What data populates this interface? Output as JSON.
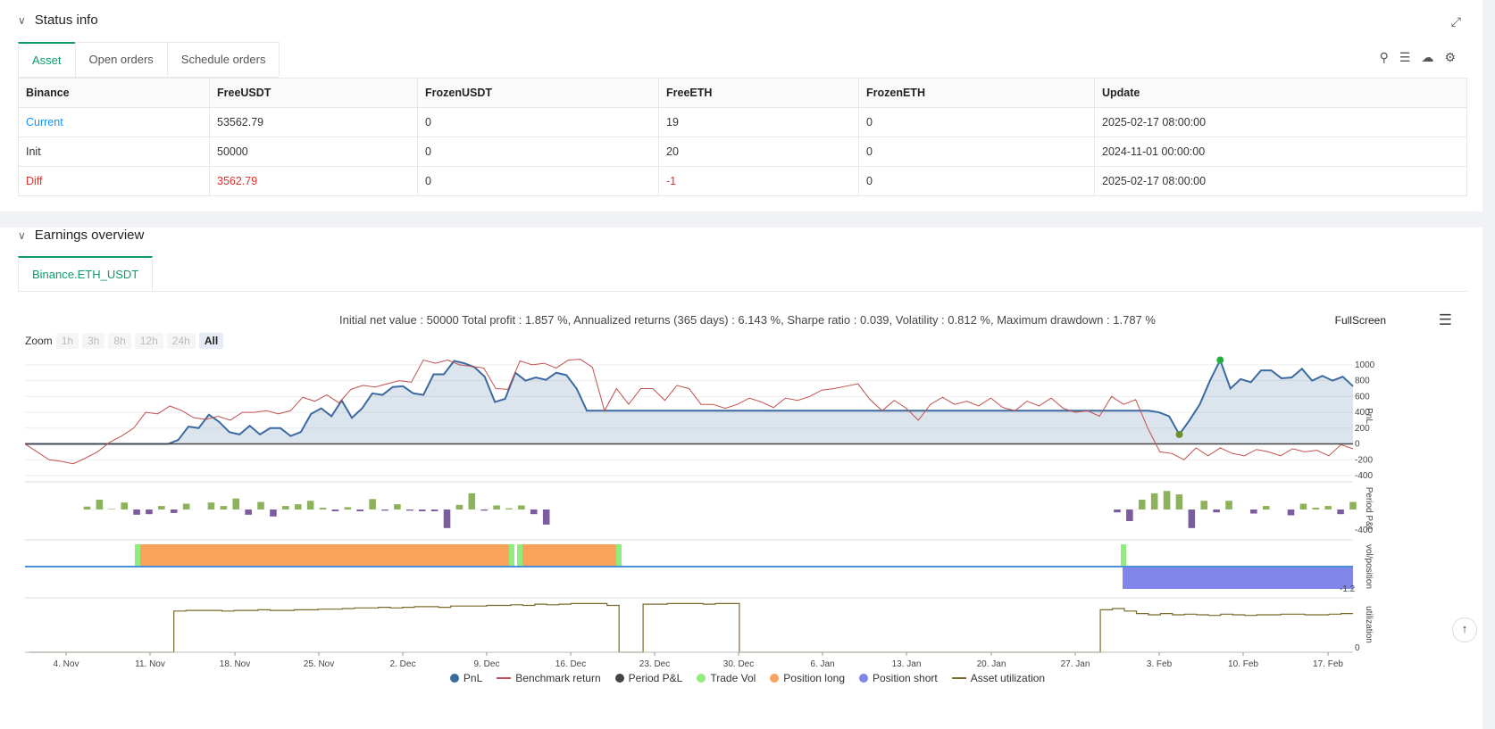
{
  "status": {
    "title": "Status info",
    "tabs": [
      "Asset",
      "Open orders",
      "Schedule orders"
    ],
    "columns": [
      "Binance",
      "FreeUSDT",
      "FrozenUSDT",
      "FreeETH",
      "FrozenETH",
      "Update"
    ],
    "rows": [
      [
        "Current",
        "53562.79",
        "0",
        "19",
        "0",
        "2025-02-17 08:00:00"
      ],
      [
        "Init",
        "50000",
        "0",
        "20",
        "0",
        "2024-11-01 00:00:00"
      ],
      [
        "Diff",
        "3562.79",
        "0",
        "-1",
        "0",
        "2025-02-17 08:00:00"
      ]
    ]
  },
  "earnings": {
    "title": "Earnings overview",
    "tab": "Binance.ETH_USDT",
    "summary": "Initial net value : 50000 Total profit : 1.857 %, Annualized returns (365 days) : 6.143 %, Sharpe ratio : 0.039, Volatility : 0.812 %, Maximum drawdown : 1.787 %",
    "fullscreen": "FullScreen",
    "zoom_label": "Zoom",
    "zoom_options": [
      "1h",
      "3h",
      "8h",
      "12h",
      "24h",
      "All"
    ],
    "legend": [
      "PnL",
      "Benchmark return",
      "Period P&L",
      "Trade Vol",
      "Position long",
      "Position short",
      "Asset utilization"
    ]
  },
  "colors": {
    "pnl": "#3b6aa0",
    "benchmark": "#c0504d",
    "period_pos": "#8cb359",
    "period_neg": "#7b5c9e",
    "trade_vol": "#90ed7d",
    "long": "#f7a35c",
    "short": "#8085e9",
    "util": "#7a6a2a",
    "accent": "#0e9b6f"
  },
  "chart_data": {
    "type": "line",
    "x_ticks": [
      "4. Nov",
      "11. Nov",
      "18. Nov",
      "25. Nov",
      "2. Dec",
      "9. Dec",
      "16. Dec",
      "23. Dec",
      "30. Dec",
      "6. Jan",
      "13. Jan",
      "20. Jan",
      "27. Jan",
      "3. Feb",
      "10. Feb",
      "17. Feb"
    ],
    "pnl_axis": {
      "ticks": [
        1000,
        800,
        600,
        400,
        200,
        0,
        -200,
        -400
      ],
      "label": "PnL"
    },
    "period_axis": {
      "label": "Period P&L",
      "ticks": [
        -400
      ]
    },
    "position_axis": {
      "label": "vol/position",
      "ticks": [
        -1.2
      ]
    },
    "util_axis": {
      "label": "utilization",
      "ticks": [
        0
      ]
    },
    "pnl": [
      0,
      0,
      0,
      0,
      0,
      0,
      0,
      0,
      0,
      0,
      0,
      0,
      0,
      0,
      0,
      50,
      220,
      200,
      370,
      280,
      150,
      120,
      230,
      120,
      200,
      200,
      100,
      150,
      380,
      450,
      350,
      550,
      330,
      450,
      640,
      620,
      720,
      730,
      640,
      620,
      880,
      880,
      1050,
      1020,
      970,
      850,
      530,
      570,
      900,
      800,
      840,
      810,
      900,
      870,
      700,
      420,
      420,
      420,
      420,
      420,
      420,
      420,
      420,
      420,
      420,
      420,
      420,
      420,
      420,
      420,
      420,
      420,
      420,
      420,
      420,
      420,
      420,
      420,
      420,
      420,
      420,
      420,
      420,
      420,
      420,
      420,
      420,
      420,
      420,
      420,
      420,
      420,
      420,
      420,
      420,
      420,
      420,
      420,
      420,
      420,
      420,
      420,
      420,
      420,
      420,
      420,
      420,
      420,
      420,
      420,
      420,
      400,
      350,
      120,
      300,
      500,
      800,
      1060,
      700,
      820,
      780,
      930,
      930,
      830,
      840,
      950,
      800,
      860,
      800,
      850,
      730
    ],
    "benchmark": [
      0,
      -100,
      -200,
      -220,
      -250,
      -180,
      -100,
      20,
      100,
      200,
      400,
      380,
      480,
      420,
      330,
      310,
      350,
      300,
      400,
      400,
      420,
      380,
      420,
      590,
      540,
      620,
      520,
      690,
      740,
      720,
      760,
      800,
      780,
      1060,
      1020,
      1060,
      1000,
      980,
      960,
      700,
      690,
      1050,
      1000,
      1020,
      960,
      1060,
      1070,
      970,
      420,
      700,
      500,
      700,
      700,
      550,
      740,
      700,
      500,
      500,
      450,
      500,
      580,
      530,
      460,
      580,
      550,
      600,
      680,
      700,
      730,
      760,
      560,
      420,
      550,
      450,
      300,
      500,
      590,
      500,
      540,
      480,
      580,
      460,
      420,
      540,
      480,
      580,
      450,
      400,
      420,
      350,
      600,
      500,
      560,
      200,
      -100,
      -120,
      -200,
      -50,
      -150,
      -50,
      -120,
      -150,
      -70,
      -100,
      -150,
      -60,
      -100,
      -80,
      -150,
      -10,
      -60
    ],
    "period_pnl": [
      0,
      0,
      0,
      0,
      0,
      50,
      170,
      10,
      120,
      -90,
      -80,
      60,
      -60,
      100,
      0,
      120,
      60,
      190,
      -90,
      130,
      -120,
      60,
      90,
      150,
      30,
      -30,
      40,
      -30,
      180,
      -20,
      90,
      -20,
      -30,
      -30,
      -320,
      80,
      280,
      -20,
      70,
      20,
      70,
      -80,
      -260,
      0,
      0,
      0,
      0,
      0,
      0,
      0,
      0,
      0,
      0,
      0,
      0,
      0,
      0,
      0,
      0,
      0,
      0,
      0,
      0,
      0,
      0,
      0,
      0,
      0,
      0,
      0,
      0,
      0,
      0,
      0,
      0,
      0,
      0,
      0,
      0,
      0,
      0,
      0,
      0,
      0,
      0,
      0,
      0,
      0,
      -50,
      -200,
      170,
      280,
      320,
      260,
      -320,
      150,
      -50,
      150,
      0,
      -70,
      60,
      0,
      -100,
      100,
      30,
      60,
      -80,
      130
    ],
    "position": {
      "long": [
        [
          "11. Nov",
          "12. Dec"
        ],
        [
          "13. Dec",
          "21. Dec"
        ]
      ],
      "short": [
        [
          "31. Jan",
          "18. Feb"
        ]
      ],
      "short_value": -1.2
    },
    "utilization": [
      0,
      0,
      0,
      0,
      0,
      0,
      0,
      0,
      0,
      0,
      0,
      0,
      0.66,
      0.67,
      0.67,
      0.67,
      0.66,
      0.67,
      0.67,
      0.68,
      0.67,
      0.67,
      0.68,
      0.68,
      0.69,
      0.69,
      0.7,
      0.71,
      0.71,
      0.72,
      0.71,
      0.72,
      0.73,
      0.73,
      0.72,
      0.74,
      0.74,
      0.74,
      0.75,
      0.75,
      0.76,
      0.75,
      0.77,
      0.76,
      0.77,
      0.78,
      0.78,
      0.78,
      0.75,
      0,
      0,
      0.77,
      0.77,
      0.78,
      0.78,
      0.78,
      0.77,
      0.78,
      0.78,
      0,
      0,
      0,
      0,
      0,
      0,
      0,
      0,
      0,
      0,
      0,
      0,
      0,
      0,
      0,
      0,
      0,
      0,
      0,
      0,
      0,
      0,
      0,
      0,
      0,
      0,
      0,
      0,
      0,
      0,
      0.68,
      0.7,
      0.66,
      0.62,
      0.6,
      0.62,
      0.6,
      0.61,
      0.6,
      0.59,
      0.61,
      0.6,
      0.59,
      0.6,
      0.6,
      0.61,
      0.61,
      0.6,
      0.6,
      0.61,
      0.62
    ]
  }
}
